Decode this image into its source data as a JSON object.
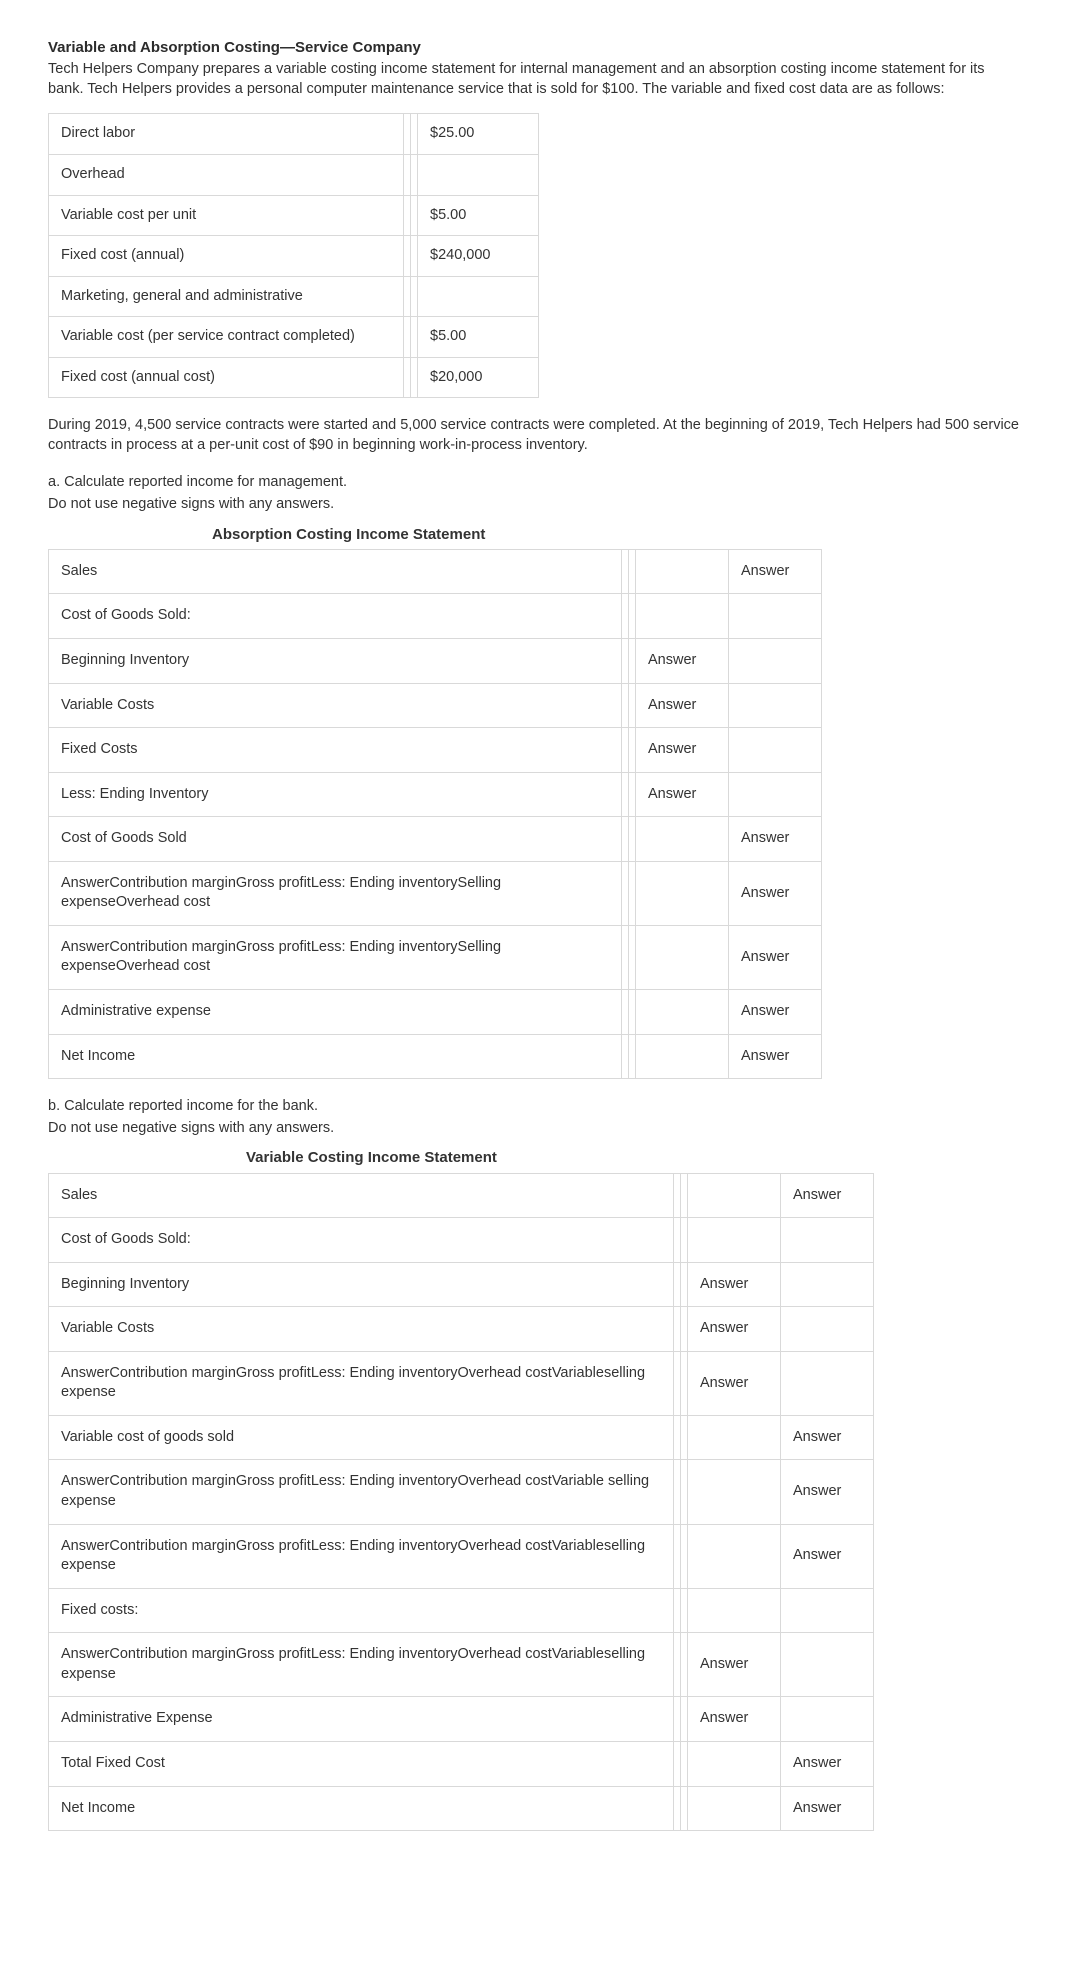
{
  "title": "Variable and Absorption Costing—Service Company",
  "intro": "Tech Helpers Company prepares a variable costing income statement for internal management and an absorption costing income statement for its bank. Tech Helpers provides a personal computer maintenance service that is sold for $100. The variable and fixed cost data are as follows:",
  "cost_table": [
    {
      "label": "Direct labor",
      "value": "$25.00"
    },
    {
      "label": "Overhead",
      "value": ""
    },
    {
      "label": "Variable cost per unit",
      "value": "$5.00"
    },
    {
      "label": "Fixed cost (annual)",
      "value": "$240,000"
    },
    {
      "label": "Marketing, general and administrative",
      "value": ""
    },
    {
      "label": "Variable cost (per service contract completed)",
      "value": "$5.00"
    },
    {
      "label": "Fixed cost (annual cost)",
      "value": "$20,000"
    }
  ],
  "mid_para": "During 2019, 4,500 service contracts were started and 5,000 service contracts were completed. At the beginning of 2019, Tech Helpers had 500 service contracts in process at a per-unit cost of $90 in beginning work-in-process inventory.",
  "part_a": {
    "heading": "a. Calculate reported income for management.",
    "note": "Do not use negative signs with any answers.",
    "table_title": "Absorption Costing Income Statement",
    "rows": [
      {
        "label": "Sales",
        "c1": "",
        "c2": "Answer"
      },
      {
        "label": "Cost of Goods Sold:",
        "c1": "",
        "c2": ""
      },
      {
        "label": "Beginning Inventory",
        "c1": "Answer",
        "c2": ""
      },
      {
        "label": "Variable Costs",
        "c1": "Answer",
        "c2": ""
      },
      {
        "label": "Fixed Costs",
        "c1": "Answer",
        "c2": ""
      },
      {
        "label": "Less: Ending Inventory",
        "c1": "Answer",
        "c2": ""
      },
      {
        "label": "Cost of Goods Sold",
        "c1": "",
        "c2": "Answer"
      },
      {
        "label": "AnswerContribution marginGross profitLess: Ending inventorySelling expenseOverhead cost",
        "c1": "",
        "c2": "Answer"
      },
      {
        "label": "AnswerContribution marginGross profitLess: Ending inventorySelling expenseOverhead cost",
        "c1": "",
        "c2": "Answer"
      },
      {
        "label": "Administrative expense",
        "c1": "",
        "c2": "Answer"
      },
      {
        "label": "Net Income",
        "c1": "",
        "c2": "Answer"
      }
    ]
  },
  "part_b": {
    "heading": "b. Calculate reported income for the bank.",
    "note": "Do not use negative signs with any answers.",
    "table_title": "Variable Costing Income Statement",
    "rows": [
      {
        "label": "Sales",
        "c1": "",
        "c2": "Answer"
      },
      {
        "label": "Cost of Goods Sold:",
        "c1": "",
        "c2": ""
      },
      {
        "label": "Beginning Inventory",
        "c1": "Answer",
        "c2": ""
      },
      {
        "label": "Variable Costs",
        "c1": "Answer",
        "c2": ""
      },
      {
        "label": "AnswerContribution marginGross profitLess: Ending inventoryOverhead costVariableselling expense",
        "c1": "Answer",
        "c2": ""
      },
      {
        "label": "Variable cost of goods sold",
        "c1": "",
        "c2": "Answer"
      },
      {
        "label": "AnswerContribution marginGross profitLess: Ending inventoryOverhead costVariable selling expense",
        "c1": "",
        "c2": "Answer"
      },
      {
        "label": "AnswerContribution marginGross profitLess: Ending inventoryOverhead costVariableselling expense",
        "c1": "",
        "c2": "Answer"
      },
      {
        "label": "Fixed costs:",
        "c1": "",
        "c2": ""
      },
      {
        "label": "AnswerContribution marginGross profitLess: Ending inventoryOverhead costVariableselling expense",
        "c1": "Answer",
        "c2": ""
      },
      {
        "label": "Administrative Expense",
        "c1": "Answer",
        "c2": ""
      },
      {
        "label": "Total Fixed Cost",
        "c1": "",
        "c2": "Answer"
      },
      {
        "label": "Net Income",
        "c1": "",
        "c2": "Answer"
      }
    ]
  }
}
